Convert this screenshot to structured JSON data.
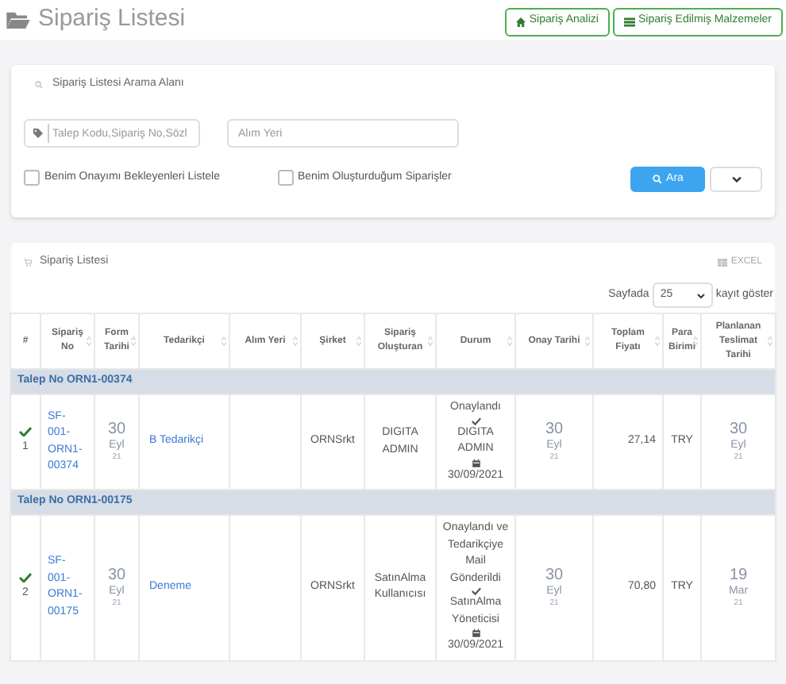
{
  "page": {
    "title": "Sipariş Listesi",
    "buttons": [
      {
        "kind": "home",
        "label": "Sipariş Analizi"
      },
      {
        "kind": "list",
        "label": "Sipariş Edilmiş Malzemeler"
      }
    ]
  },
  "search": {
    "title": "Sipariş Listesi Arama Alanı",
    "keyword": {
      "placeholder": "Talep Kodu,Sipariş No,Sözl"
    },
    "location": {
      "placeholder": "Alım Yeri"
    },
    "checkboxes": [
      {
        "label": "Benim Onayımı Bekleyenleri Listele",
        "checked": false
      },
      {
        "label": "Benim Oluşturduğum Siparişler",
        "checked": false
      }
    ],
    "search_button": "Ara"
  },
  "list": {
    "title": "Sipariş Listesi",
    "excel": "EXCEL",
    "page_size_prefix": "Sayfada",
    "page_size": "25",
    "page_size_suffix": "kayıt göster",
    "columns": [
      {
        "label": "#",
        "sortable": false
      },
      {
        "label": "Sipariş No",
        "sortable": true
      },
      {
        "label": "Form Tarihi",
        "sortable": true
      },
      {
        "label": "Tedarikçi",
        "sortable": true
      },
      {
        "label": "Alım Yeri",
        "sortable": true
      },
      {
        "label": "Şirket",
        "sortable": true
      },
      {
        "label": "Sipariş Oluşturan",
        "sortable": true
      },
      {
        "label": "Durum",
        "sortable": true
      },
      {
        "label": "Onay Tarihi",
        "sortable": true
      },
      {
        "label": "Toplam Fiyatı",
        "sortable": true
      },
      {
        "label": "Para Birimi",
        "sortable": true
      },
      {
        "label": "Planlanan Teslimat Tarihi",
        "sortable": true
      }
    ],
    "groups": [
      {
        "title": "Talep No ORN1-00374",
        "rows": [
          {
            "approved": true,
            "index": "1",
            "order_no": "SF-001-ORN1-00374",
            "form_date": {
              "day": "30",
              "month": "Eyl",
              "year": "21"
            },
            "supplier": "B Tedarikçi",
            "company": "ORNSrkt",
            "creator": "DIGITA ADMIN",
            "status": {
              "text": "Onaylandı",
              "approver": "DIGITA ADMIN",
              "date": "30/09/2021"
            },
            "approval_date": {
              "day": "30",
              "month": "Eyl",
              "year": "21"
            },
            "total": "27,14",
            "currency": "TRY",
            "delivery_date": {
              "day": "30",
              "month": "Eyl",
              "year": "21"
            }
          }
        ]
      },
      {
        "title": "Talep No ORN1-00175",
        "rows": [
          {
            "approved": true,
            "index": "2",
            "order_no": "SF-001-ORN1-00175",
            "form_date": {
              "day": "30",
              "month": "Eyl",
              "year": "21"
            },
            "supplier": "Deneme",
            "company": "ORNSrkt",
            "creator": "SatınAlma Kullanıcısı",
            "status": {
              "text": "Onaylandı ve Tedarikçiye Mail Gönderildi",
              "approver": "SatınAlma Yöneticisi",
              "date": "30/09/2021"
            },
            "approval_date": {
              "day": "30",
              "month": "Eyl",
              "year": "21"
            },
            "total": "70,80",
            "currency": "TRY",
            "delivery_date": {
              "day": "19",
              "month": "Mar",
              "year": "21"
            }
          }
        ]
      }
    ]
  }
}
